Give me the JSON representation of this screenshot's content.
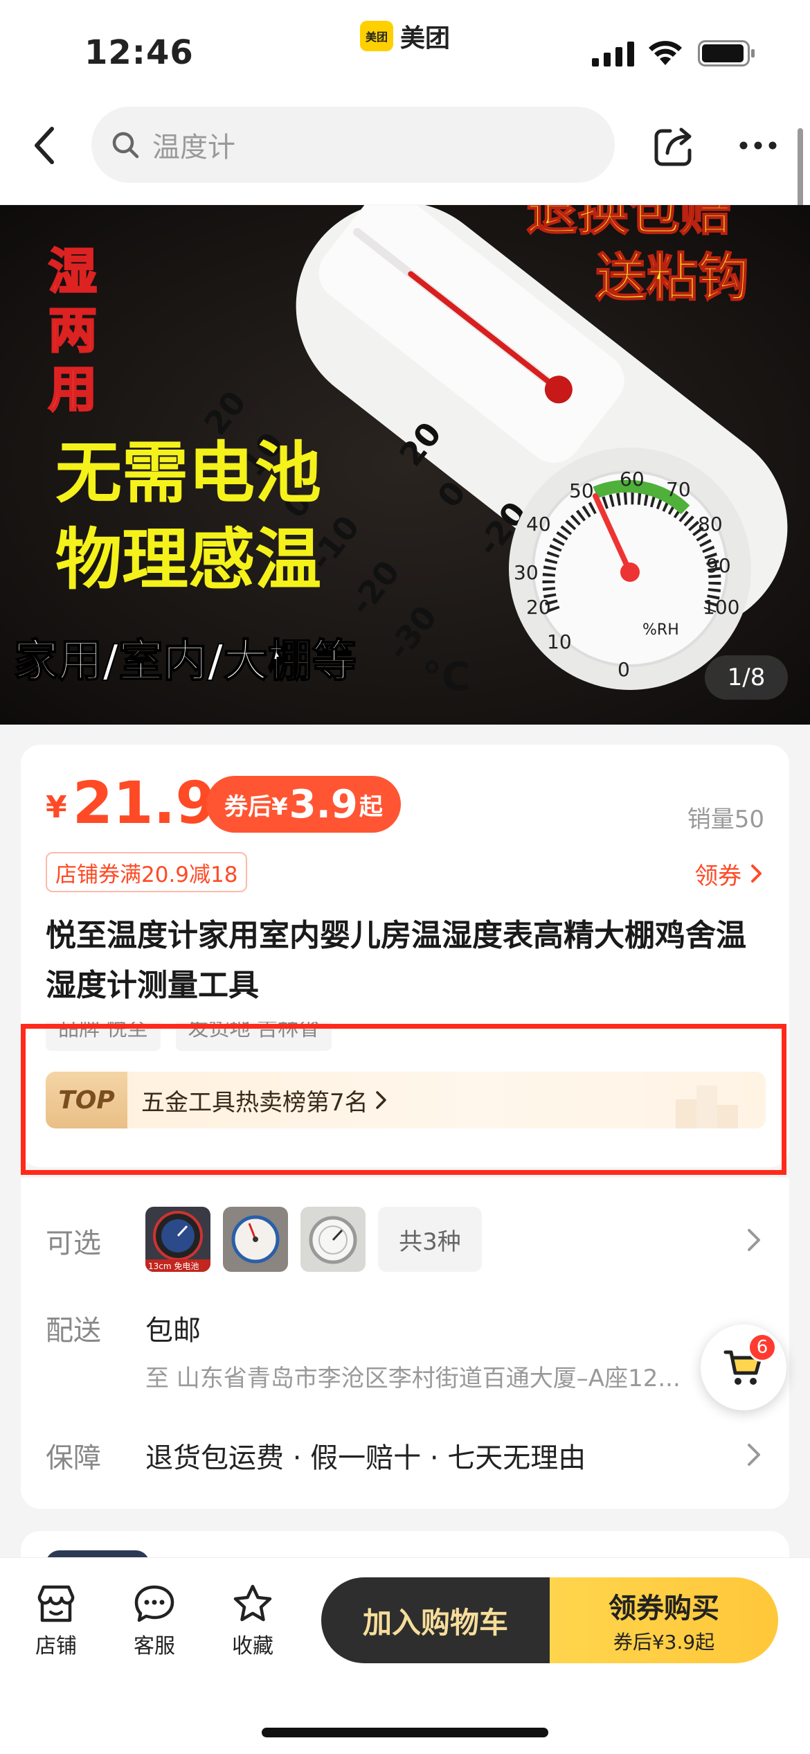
{
  "status_bar": {
    "time": "12:46",
    "app_name": "美团",
    "app_logo_text": "美团"
  },
  "nav": {
    "search_placeholder": "温度计"
  },
  "hero": {
    "counter": "1/8",
    "overlay_texts": {
      "left_vertical": "湿两用",
      "top_right_1": "退换包赔",
      "top_right_2": "送粘钩",
      "mid_1": "无需电池",
      "mid_2": "物理感温",
      "bottom": "家用/室内/大棚等"
    }
  },
  "product": {
    "currency": "¥",
    "price": "21.9",
    "coupon_price_prefix": "券后¥",
    "coupon_price_value": "3.9",
    "coupon_price_suffix": "起",
    "sales": "销量50",
    "shop_coupon": "店铺券满20.9减18",
    "get_coupon": "领券",
    "title": "悦至温度计家用室内婴儿房温湿度表高精大棚鸡舍温湿度计测量工具",
    "tags": [
      "品牌 悦至",
      "发货地 吉林省"
    ],
    "top_badge": "TOP",
    "top_rank_text": "五金工具热卖榜第7名"
  },
  "options": {
    "label_optional": "可选",
    "thumb_1_caption": "13cm 免电池",
    "total_variants": "共3种",
    "label_delivery": "配送",
    "delivery_value": "包邮",
    "address": "至 山东省青岛市李沧区李村街道百通大厦–A座12...",
    "label_guarantee": "保障",
    "guarantee_value": "退货包运费 · 假一赔十 · 七天无理由"
  },
  "float_cart": {
    "badge": "6"
  },
  "bottom_bar": {
    "shop": "店铺",
    "service": "客服",
    "favorite": "收藏",
    "add_to_cart": "加入购物车",
    "buy_main": "领券购买",
    "buy_sub": "券后¥3.9起"
  },
  "colors": {
    "accent": "#ff4a26",
    "cta_dark": "#2e2e2e",
    "cta_yellow": "#ffd54d",
    "highlight_box": "#ff2a1a"
  }
}
